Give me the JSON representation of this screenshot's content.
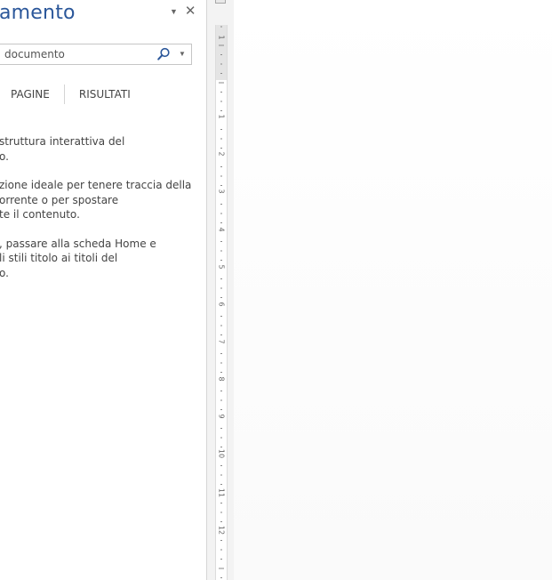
{
  "nav_pane": {
    "title": "amento",
    "menu_icon": "dropdown-arrow-icon",
    "close_icon": "close-icon",
    "search": {
      "value": "documento",
      "search_icon": "search-icon",
      "dropdown_icon": "chevron-down-icon"
    },
    "tabs": [
      {
        "label": "PAGINE"
      },
      {
        "label": "RISULTATI"
      }
    ],
    "help_paragraphs": [
      {
        "lines": [
          "struttura interattiva del",
          "o."
        ]
      },
      {
        "lines": [
          "zione ideale per tenere traccia della",
          "orrente o per spostare",
          "te il contenuto."
        ]
      },
      {
        "lines": [
          ", passare alla scheda Home e",
          "li stili titolo ai titoli del",
          "o."
        ]
      }
    ]
  },
  "ruler": {
    "numbers": [
      "1",
      "1",
      "2",
      "3",
      "4",
      "5",
      "6",
      "7",
      "8",
      "9",
      "10",
      "11",
      "12"
    ]
  },
  "colors": {
    "title": "#2b579a",
    "text": "#444444",
    "ruler_bg": "#f3f3f3",
    "ruler_margin": "#e4e4e4",
    "divider": "#d6d6d6"
  }
}
